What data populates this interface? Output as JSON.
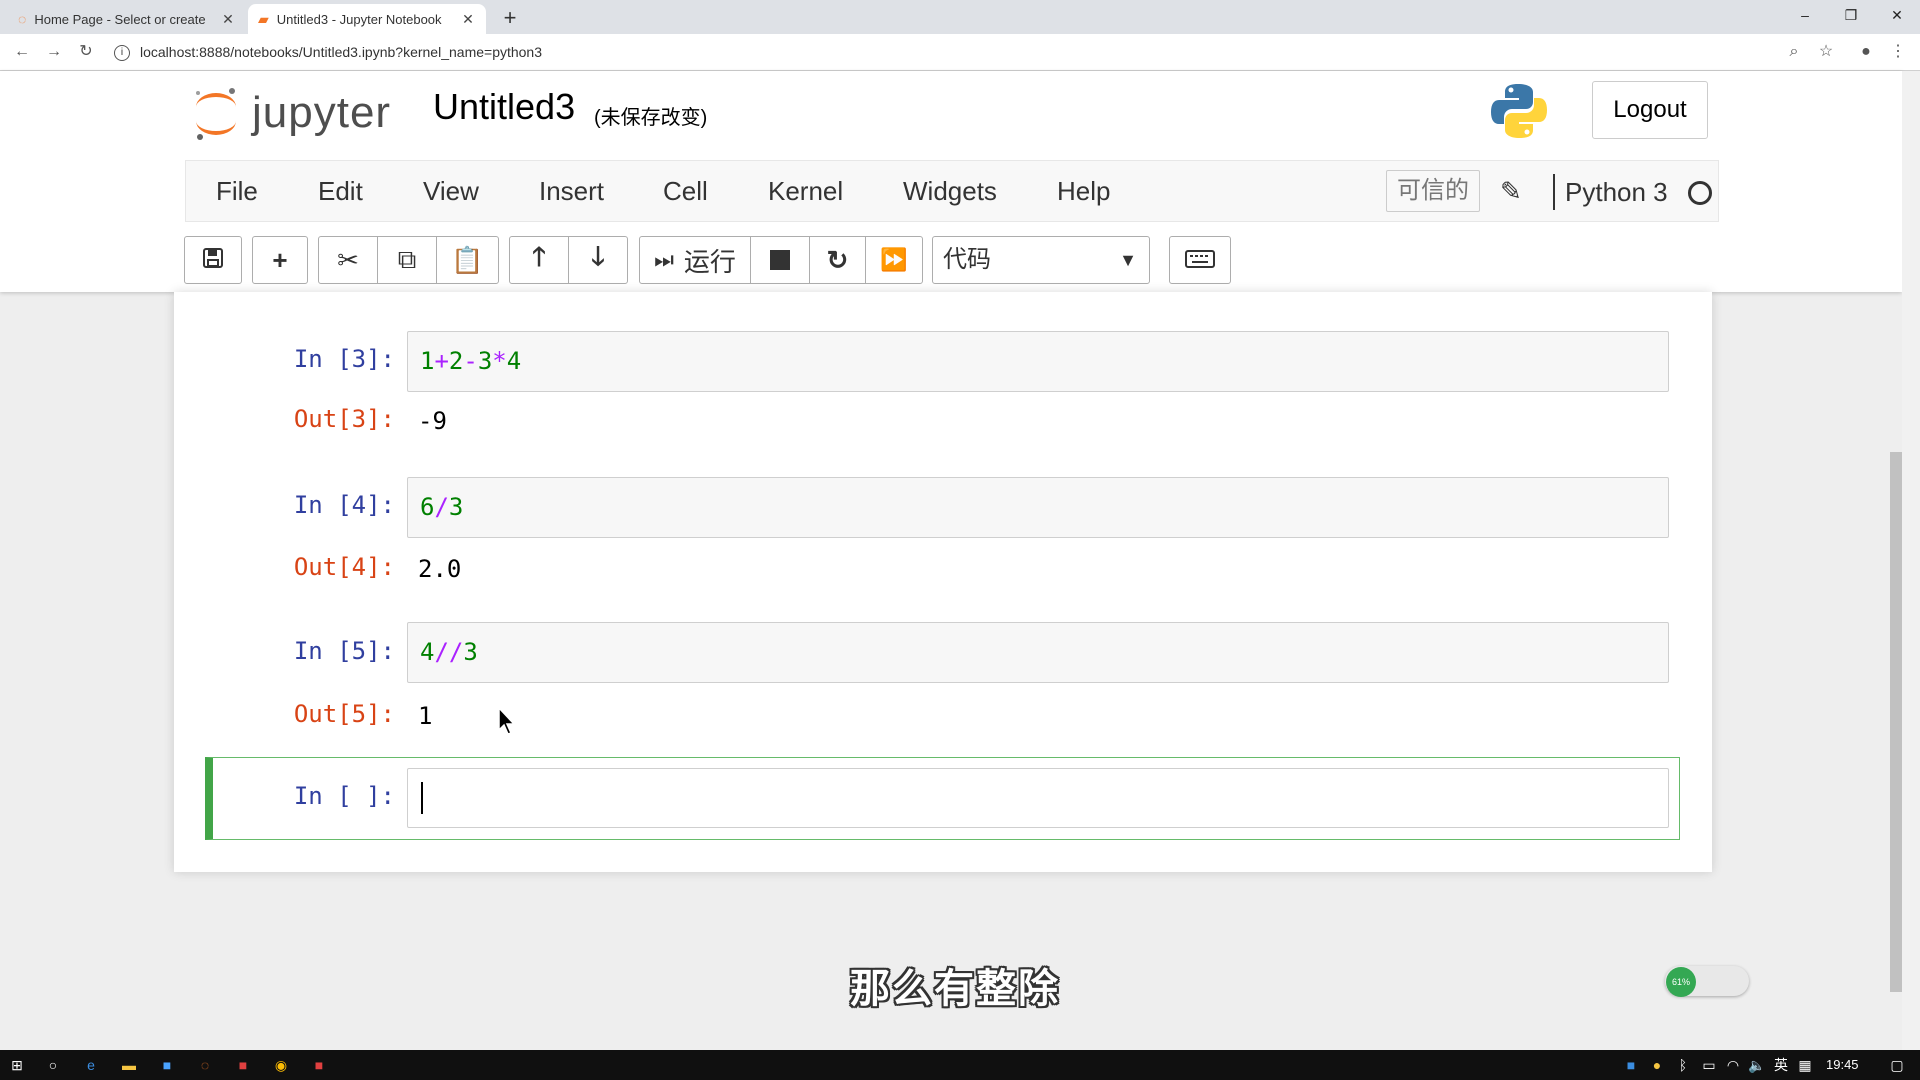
{
  "browser": {
    "tabs": [
      {
        "title": "Home Page - Select or create",
        "active": false
      },
      {
        "title": "Untitled3 - Jupyter Notebook",
        "active": true
      }
    ],
    "new_tab_label": "+",
    "url": "localhost:8888/notebooks/Untitled3.ipynb?kernel_name=python3",
    "window_controls": {
      "minimize": "–",
      "restore": "❐",
      "close": "✕"
    }
  },
  "header": {
    "logo_text": "jupyter",
    "notebook_name": "Untitled3",
    "save_status": "(未保存改变)",
    "logout_label": "Logout"
  },
  "menubar": {
    "items": [
      "File",
      "Edit",
      "View",
      "Insert",
      "Cell",
      "Kernel",
      "Widgets",
      "Help"
    ],
    "trusted_label": "可信的",
    "kernel_name": "Python 3"
  },
  "toolbar": {
    "run_label": "运行",
    "cell_type": "代码",
    "icons": [
      "save-icon",
      "plus-icon",
      "cut-icon",
      "copy-icon",
      "paste-icon",
      "arrow-up-icon",
      "arrow-down-icon",
      "run-icon",
      "stop-icon",
      "restart-icon",
      "fast-forward-icon",
      "keyboard-icon"
    ]
  },
  "cells": [
    {
      "in_prompt": "In  [3]:",
      "out_prompt": "Out[3]:",
      "output": "-9"
    },
    {
      "in_prompt": "In  [4]:",
      "out_prompt": "Out[4]:",
      "output": "2.0"
    },
    {
      "in_prompt": "In  [5]:",
      "out_prompt": "Out[5]:",
      "output": "1"
    }
  ],
  "code": {
    "c3": {
      "t1": "1",
      "t2": "+",
      "t3": "2",
      "t4": "-",
      "t5": "3",
      "t6": "*",
      "t7": "4"
    },
    "c4": {
      "t1": "6",
      "t2": "/",
      "t3": "3"
    },
    "c5": {
      "t1": "4",
      "t2": "//",
      "t3": "3"
    }
  },
  "active_cell": {
    "in_prompt": "In  [ ]:"
  },
  "subtitle": "那么有整除",
  "speed_widget": {
    "percent": "61%"
  },
  "taskbar": {
    "clock": "19:45",
    "ime": "英"
  }
}
